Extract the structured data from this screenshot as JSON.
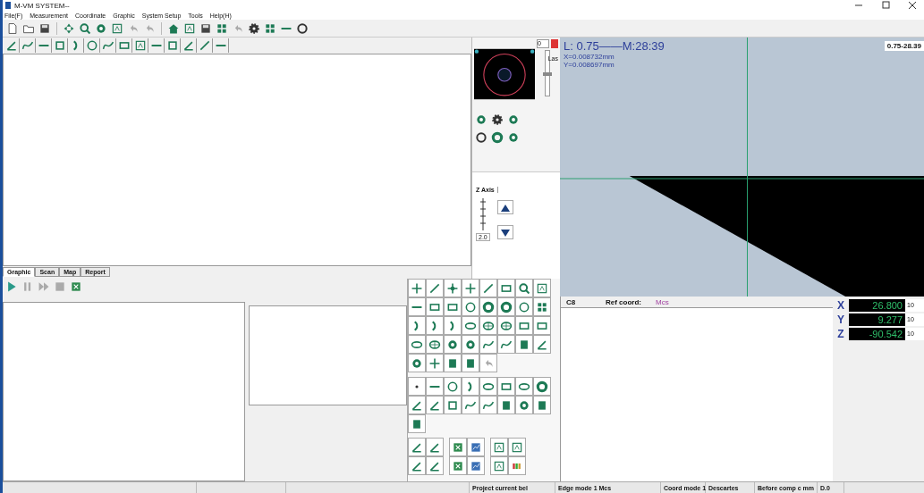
{
  "window": {
    "title": "M-VM SYSTEM--"
  },
  "menu": [
    "File(F)",
    "Measurement",
    "Coordinate",
    "Graphic",
    "System Setup",
    "Tools",
    "Help(H)"
  ],
  "light_panel": {
    "value": "0",
    "label": "Las",
    "level": 0.45
  },
  "z_axis": {
    "tab": "Z Axis",
    "value": "2.0"
  },
  "camera": {
    "scale_text": "L: 0.75——M:28:39",
    "x_text": "X=0.008732mm",
    "y_text": "Y=0.008697mm",
    "zoom": "0.75-28.39"
  },
  "tabs": [
    {
      "label": "Graphic",
      "selected": true
    },
    {
      "label": "Scan",
      "selected": false
    },
    {
      "label": "Map",
      "selected": false
    },
    {
      "label": "Report",
      "selected": false
    }
  ],
  "results": {
    "column_1": "C8",
    "ref_label": "Ref coord:",
    "ref_value": "Mcs"
  },
  "dro": [
    {
      "axis": "X",
      "value": "26.800",
      "unit": "10"
    },
    {
      "axis": "Y",
      "value": "9.277",
      "unit": "10"
    },
    {
      "axis": "Z",
      "value": "-90.542",
      "unit": "10"
    }
  ],
  "status_bar": [
    "Project current bel",
    "Edge mode 1 Mcs",
    "Coord mode 1",
    "Descartes",
    "Before comp c mm",
    "D.0"
  ]
}
